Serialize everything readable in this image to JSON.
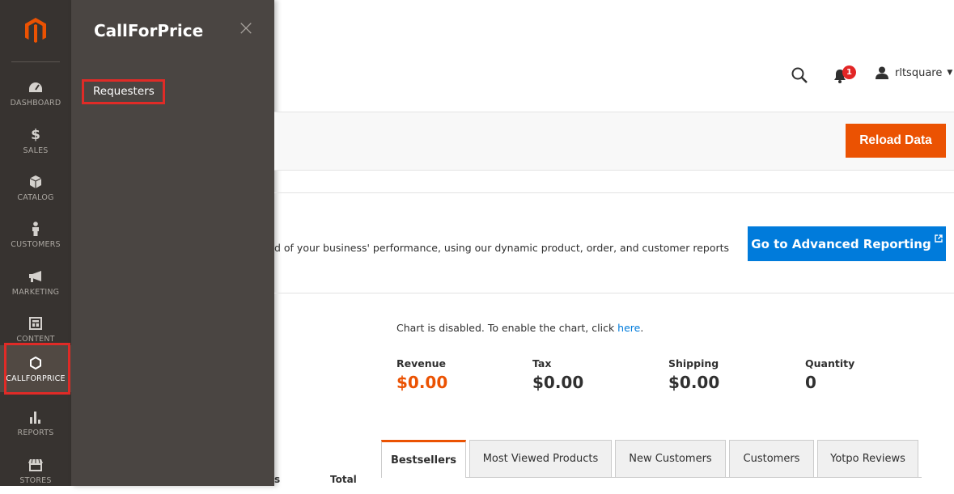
{
  "nav": {
    "items": [
      {
        "label": "DASHBOARD",
        "icon": "dashboard-icon"
      },
      {
        "label": "SALES",
        "icon": "dollar-icon"
      },
      {
        "label": "CATALOG",
        "icon": "box-icon"
      },
      {
        "label": "CUSTOMERS",
        "icon": "person-icon"
      },
      {
        "label": "MARKETING",
        "icon": "megaphone-icon"
      },
      {
        "label": "CONTENT",
        "icon": "layout-icon"
      },
      {
        "label": "CALLFORPRICE",
        "icon": "hexagon-icon"
      },
      {
        "label": "REPORTS",
        "icon": "bar-chart-icon"
      },
      {
        "label": "STORES",
        "icon": "store-icon"
      }
    ]
  },
  "submenu": {
    "title": "CallForPrice",
    "close": "×",
    "link": "Requesters"
  },
  "header": {
    "notifications_count": "1",
    "username": "rltsquare"
  },
  "toolbar": {
    "reload_label": "Reload Data"
  },
  "advanced": {
    "text": "d of your business' performance, using our dynamic product, order, and customer reports",
    "button_label": "Go to Advanced Reporting",
    "button_icon": "external-link-icon"
  },
  "chart_notice": {
    "text": "Chart is disabled. To enable the chart, click ",
    "link": "here",
    "after": "."
  },
  "totals": [
    {
      "label": "Revenue",
      "value": "$0.00"
    },
    {
      "label": "Tax",
      "value": "$0.00"
    },
    {
      "label": "Shipping",
      "value": "$0.00"
    },
    {
      "label": "Quantity",
      "value": "0"
    }
  ],
  "tabs": [
    "Bestsellers",
    "Most Viewed Products",
    "New Customers",
    "Customers",
    "Yotpo Reviews"
  ],
  "table": {
    "col_partial": "s",
    "col_total": "Total"
  },
  "colors": {
    "accent_orange": "#eb5202",
    "accent_blue": "#007bdb",
    "nav_bg": "#373330",
    "highlight_red": "#e02b27"
  }
}
